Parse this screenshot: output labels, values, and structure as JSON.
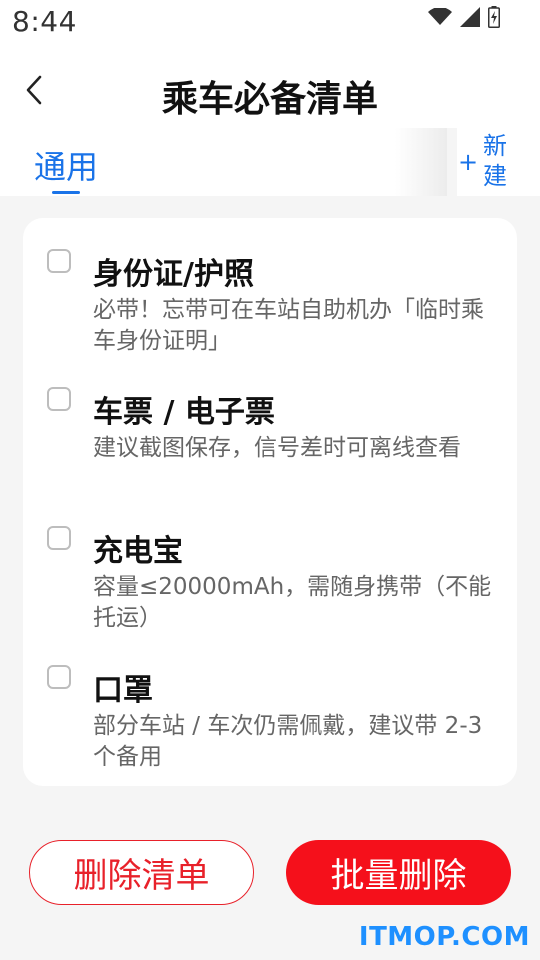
{
  "status_bar": {
    "time": "8:44",
    "icons": [
      "wifi-icon",
      "signal-icon",
      "battery-charging-icon"
    ]
  },
  "header": {
    "title": "乘车必备清单"
  },
  "tabs": {
    "active": "通用",
    "new_plus": "+",
    "new_label": "新建"
  },
  "checklist": {
    "items": [
      {
        "title": "身份证/护照",
        "desc": "必带！忘带可在车站自助机办「临时乘车身份证明」",
        "checked": false
      },
      {
        "title": "车票 / 电子票",
        "desc": "建议截图保存，信号差时可离线查看",
        "checked": false
      },
      {
        "title": "充电宝",
        "desc": "容量≤20000mAh，需随身携带（不能托运）",
        "checked": false
      },
      {
        "title": "口罩",
        "desc": "部分车站 / 车次仍需佩戴，建议带 2-3 个备用",
        "checked": false
      }
    ]
  },
  "actions": {
    "delete_list": "删除清单",
    "batch_delete": "批量删除"
  },
  "watermark": "ITMOP.COM",
  "colors": {
    "accent": "#1a73e8",
    "danger": "#f5101b",
    "background": "#f5f5f5",
    "card": "#ffffff",
    "watermark": "#1e90ff"
  }
}
